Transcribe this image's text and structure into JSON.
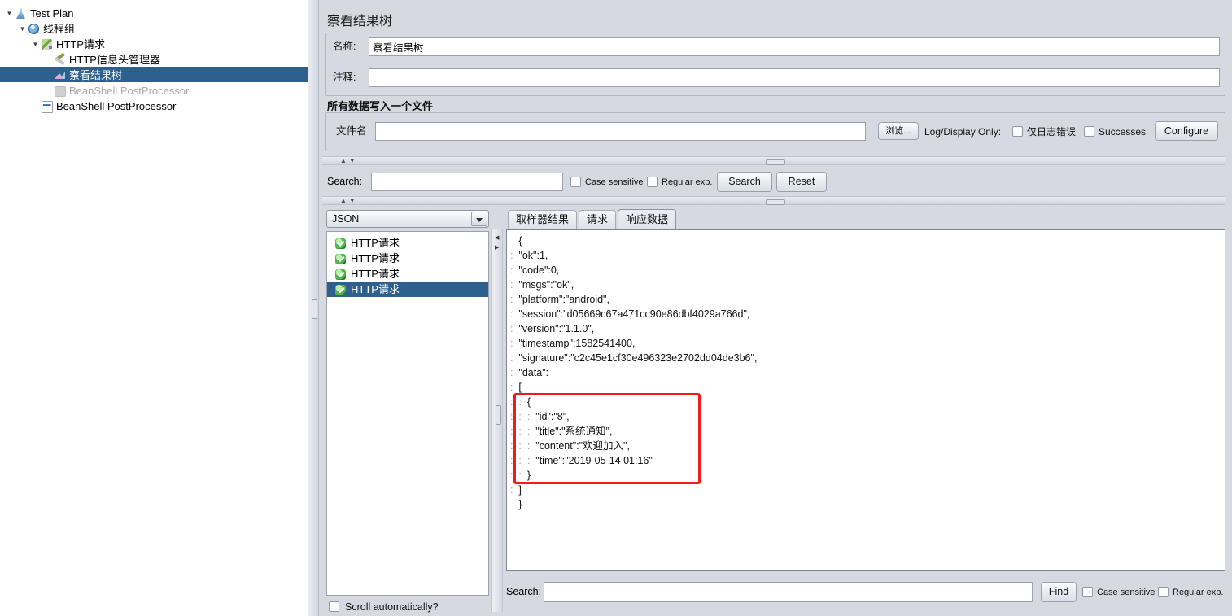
{
  "tree": {
    "items": [
      {
        "label": "Test Plan",
        "icon": "flask-icon",
        "indent": 0,
        "toggle": "▼",
        "state": "normal"
      },
      {
        "label": "线程组",
        "icon": "gear-icon",
        "indent": 1,
        "toggle": "▼",
        "state": "normal"
      },
      {
        "label": "HTTP请求",
        "icon": "pen-icon",
        "indent": 2,
        "toggle": "▼",
        "state": "normal"
      },
      {
        "label": "HTTP信息头管理器",
        "icon": "tools-icon",
        "indent": 3,
        "toggle": "",
        "state": "normal"
      },
      {
        "label": "察看结果树",
        "icon": "results-tree-icon",
        "indent": 3,
        "toggle": "",
        "state": "selected"
      },
      {
        "label": "BeanShell PostProcessor",
        "icon": "postprocessor-disabled-icon",
        "indent": 3,
        "toggle": "",
        "state": "disabled"
      },
      {
        "label": "BeanShell PostProcessor",
        "icon": "postprocessor-icon",
        "indent": 2,
        "toggle": "",
        "state": "normal"
      }
    ]
  },
  "header": {
    "title": "察看结果树"
  },
  "form": {
    "name_label": "名称:",
    "name_value": "察看结果树",
    "comment_label": "注释:",
    "comment_value": "",
    "filegroup_title": "所有数据写入一个文件",
    "filename_label": "文件名",
    "filename_value": "",
    "browse_button": "浏览...",
    "log_display_only_label": "Log/Display Only:",
    "errors_only_label": "仅日志错误",
    "successes_label": "Successes",
    "configure_button": "Configure"
  },
  "upper_search": {
    "label": "Search:",
    "value": "",
    "case_sensitive_label": "Case sensitive",
    "regular_exp_label": "Regular exp.",
    "search_button": "Search",
    "reset_button": "Reset"
  },
  "results": {
    "renderer_selected": "JSON",
    "samples": [
      {
        "label": "HTTP请求",
        "status": "success",
        "selected": false
      },
      {
        "label": "HTTP请求",
        "status": "success",
        "selected": false
      },
      {
        "label": "HTTP请求",
        "status": "success",
        "selected": false
      },
      {
        "label": "HTTP请求",
        "status": "success",
        "selected": true
      }
    ],
    "scroll_automatically_label": "Scroll automatically?",
    "tabs": [
      {
        "label": "取样器结果",
        "active": false
      },
      {
        "label": "请求",
        "active": false
      },
      {
        "label": "响应数据",
        "active": true
      }
    ]
  },
  "response_body": {
    "lines": [
      {
        "guide": "",
        "text": "{"
      },
      {
        "guide": ":",
        "text": "\"ok\":1,"
      },
      {
        "guide": ":",
        "text": "\"code\":0,"
      },
      {
        "guide": ":",
        "text": "\"msgs\":\"ok\","
      },
      {
        "guide": ":",
        "text": "\"platform\":\"android\","
      },
      {
        "guide": ":",
        "text": "\"session\":\"d05669c67a471cc90e86dbf4029a766d\","
      },
      {
        "guide": ":",
        "text": "\"version\":\"1.1.0\","
      },
      {
        "guide": ":",
        "text": "\"timestamp\":1582541400,"
      },
      {
        "guide": ":",
        "text": "\"signature\":\"c2c45e1cf30e496323e2702dd04de3b6\","
      },
      {
        "guide": ":",
        "text": "\"data\":"
      },
      {
        "guide": ":",
        "text": "["
      },
      {
        "guide": ":  :",
        "text": "{"
      },
      {
        "guide": ":  :  :",
        "text": "\"id\":\"8\","
      },
      {
        "guide": ":  :  :",
        "text": "\"title\":\"系统通知\","
      },
      {
        "guide": ":  :  :",
        "text": "\"content\":\"欢迎加入\","
      },
      {
        "guide": ":  :  :",
        "text": "\"time\":\"2019-05-14 01:16\""
      },
      {
        "guide": ":  :",
        "text": "}"
      },
      {
        "guide": ":",
        "text": "]"
      },
      {
        "guide": "",
        "text": "}"
      }
    ],
    "highlight_color": "#f21b1b"
  },
  "bottom_search": {
    "label": "Search:",
    "value": "",
    "find_button": "Find",
    "case_sensitive_label": "Case sensitive",
    "regular_exp_label": "Regular exp."
  },
  "colors": {
    "selection": "#2d608c",
    "panel": "#d6d9e0",
    "accent_red": "#f21b1b"
  }
}
